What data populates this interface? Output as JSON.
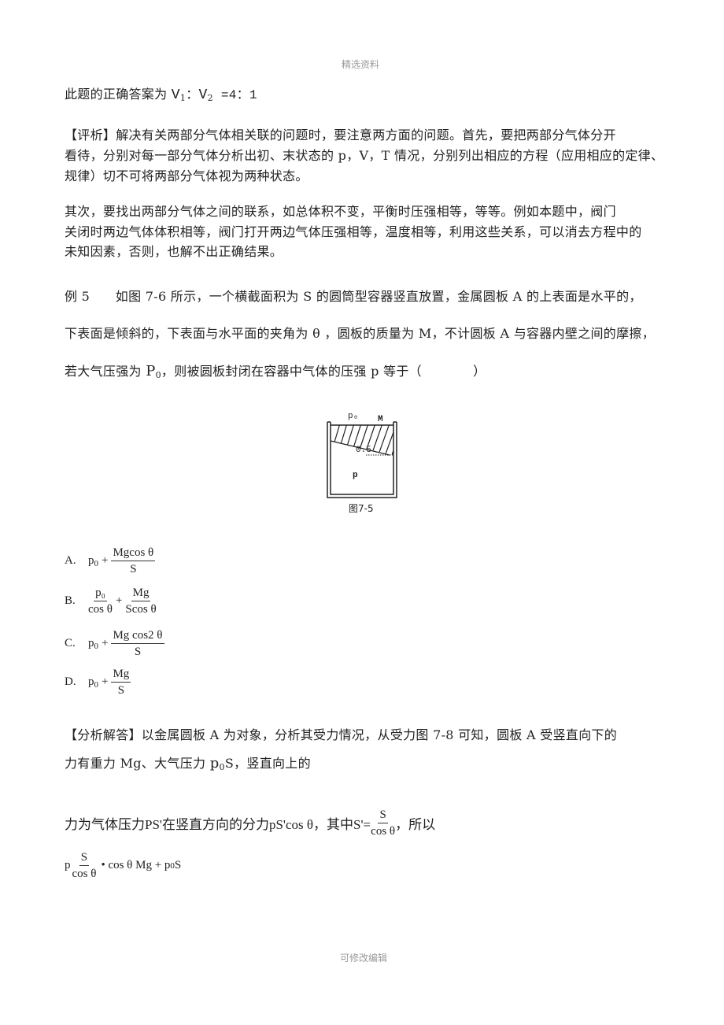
{
  "header": {
    "watermark_top": "精选资料"
  },
  "answer_line": {
    "prefix": "此题的正确答案为 ",
    "v1": "V",
    "v1_sub": "1",
    "colon1": "：",
    "v2": "V",
    "v2_sub": "2",
    "ratio": " =4：1"
  },
  "comment": {
    "line1": "【评析】解决有关两部分气体相关联的问题时，要注意两方面的问题。首先，要把两部分气体分开",
    "line2": "看待，分别对每一部分气体分析出初、末状态的 p，V，T 情况，分别列出相应的方程（应用相应的定律、",
    "line3": "规律）切不可将两部分气体视为两种状态。"
  },
  "second": {
    "line1": "其次，要找出两部分气体之间的联系，如总体积不变，平衡时压强相等，等等。例如本题中，阀门",
    "line2": "关闭时两边气体体积相等，阀门打开两边气体压强相等，温度相等，利用这些关系，可以消去方程中的",
    "line3": "未知因素，否则，也解不出正确结果。"
  },
  "example": {
    "line1": "例 5　　如图 7-6 所示，一个横截面积为 S 的圆筒型容器竖直放置，金属圆板 A 的上表面是水平的，",
    "line2": "下表面是倾斜的，下表面与水平面的夹角为 θ ，圆板的质量为 M，不计圆板 A 与容器内壁之间的摩擦，",
    "line3_prefix": "若大气压强为 ",
    "line3_p": "P",
    "line3_sub": "0",
    "line3_suffix": "，则被圆板封闭在容器中气体的压强 p 等于（　　　　）"
  },
  "figure": {
    "label_p0": "p₀",
    "label_m": "M",
    "label_angle": "0.5",
    "label_p": "p",
    "caption": "图7-5"
  },
  "options": [
    {
      "label": "A.",
      "lead": "p",
      "lead_sub": "0",
      "op": "+",
      "num": "Mgcos θ",
      "den": "S"
    },
    {
      "label": "B.",
      "num1": "p₀",
      "den1": "cos θ",
      "op": "+",
      "num": "Mg",
      "den": "Scos θ"
    },
    {
      "label": "C.",
      "lead": "p",
      "lead_sub": "0",
      "op": "+",
      "num": "Mg cos2 θ",
      "den": "S"
    },
    {
      "label": "D.",
      "lead": "p",
      "lead_sub": "0",
      "op": "+",
      "num": "Mg",
      "den": "S"
    }
  ],
  "analysis": {
    "line1": "【分析解答】以金属圆板 A 为对象，分析其受力情况，从受力图 7-8 可知，圆板 A 受竖直向下的",
    "line2_prefix": "力有重力 Mg、大气压力 ",
    "line2_p": "p",
    "line2_sub": "0",
    "line2_suffix": "S，竖直向上的"
  },
  "derivation": {
    "line1_prefix": "力为气体压力PS'在竖直方向的分力pS'cos θ，其中S'=",
    "line1_num": "S",
    "line1_den": "cos θ",
    "line1_suffix": "，所以",
    "line2_p": "p",
    "line2_num": "S",
    "line2_den": "cos θ",
    "line2_rest": " • cos θ Mg + p",
    "line2_sub": "0",
    "line2_end": "S"
  },
  "footer": {
    "watermark_bottom": "可修改编辑"
  }
}
